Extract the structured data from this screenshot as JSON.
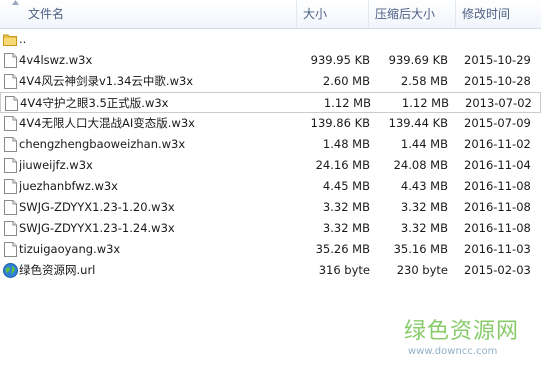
{
  "columns": {
    "name": "文件名",
    "size": "大小",
    "compressed": "压缩后大小",
    "modified": "修改时间"
  },
  "parent_label": "..",
  "files": [
    {
      "name": "4v4lswz.w3x",
      "size": "939.95 KB",
      "compressed": "939.69 KB",
      "date": "2015-10-29",
      "icon": "document-icon"
    },
    {
      "name": "4V4风云神剑录v1.34云中歌.w3x",
      "size": "2.60 MB",
      "compressed": "2.58 MB",
      "date": "2015-10-28",
      "icon": "document-icon"
    },
    {
      "name": "4V4守护之眼3.5正式版.w3x",
      "size": "1.12 MB",
      "compressed": "1.12 MB",
      "date": "2013-07-02",
      "icon": "document-icon"
    },
    {
      "name": "4V4无限人口大混战AI变态版.w3x",
      "size": "139.86 KB",
      "compressed": "139.44 KB",
      "date": "2015-07-09",
      "icon": "document-icon"
    },
    {
      "name": "chengzhengbaoweizhan.w3x",
      "size": "1.48 MB",
      "compressed": "1.44 MB",
      "date": "2016-11-02",
      "icon": "document-icon"
    },
    {
      "name": "jiuweijfz.w3x",
      "size": "24.16 MB",
      "compressed": "24.08 MB",
      "date": "2016-11-04",
      "icon": "document-icon"
    },
    {
      "name": "juezhanbfwz.w3x",
      "size": "4.45 MB",
      "compressed": "4.43 MB",
      "date": "2016-11-08",
      "icon": "document-icon"
    },
    {
      "name": "SWJG-ZDYYX1.23-1.20.w3x",
      "size": "3.32 MB",
      "compressed": "3.32 MB",
      "date": "2016-11-08",
      "icon": "document-icon"
    },
    {
      "name": "SWJG-ZDYYX1.23-1.24.w3x",
      "size": "3.32 MB",
      "compressed": "3.32 MB",
      "date": "2016-11-08",
      "icon": "document-icon"
    },
    {
      "name": "tizuigaoyang.w3x",
      "size": "35.26 MB",
      "compressed": "35.16 MB",
      "date": "2016-11-03",
      "icon": "document-icon"
    },
    {
      "name": "绿色资源网.url",
      "size": "316 byte",
      "compressed": "230 byte",
      "date": "2015-02-03",
      "icon": "globe-icon"
    }
  ],
  "watermark": {
    "text": "绿色资源网",
    "url": "www.downcc.com"
  },
  "colors": {
    "header_text": "#4d6185",
    "folder": "#e8c14a",
    "watermark_green": "#88cc6a"
  }
}
